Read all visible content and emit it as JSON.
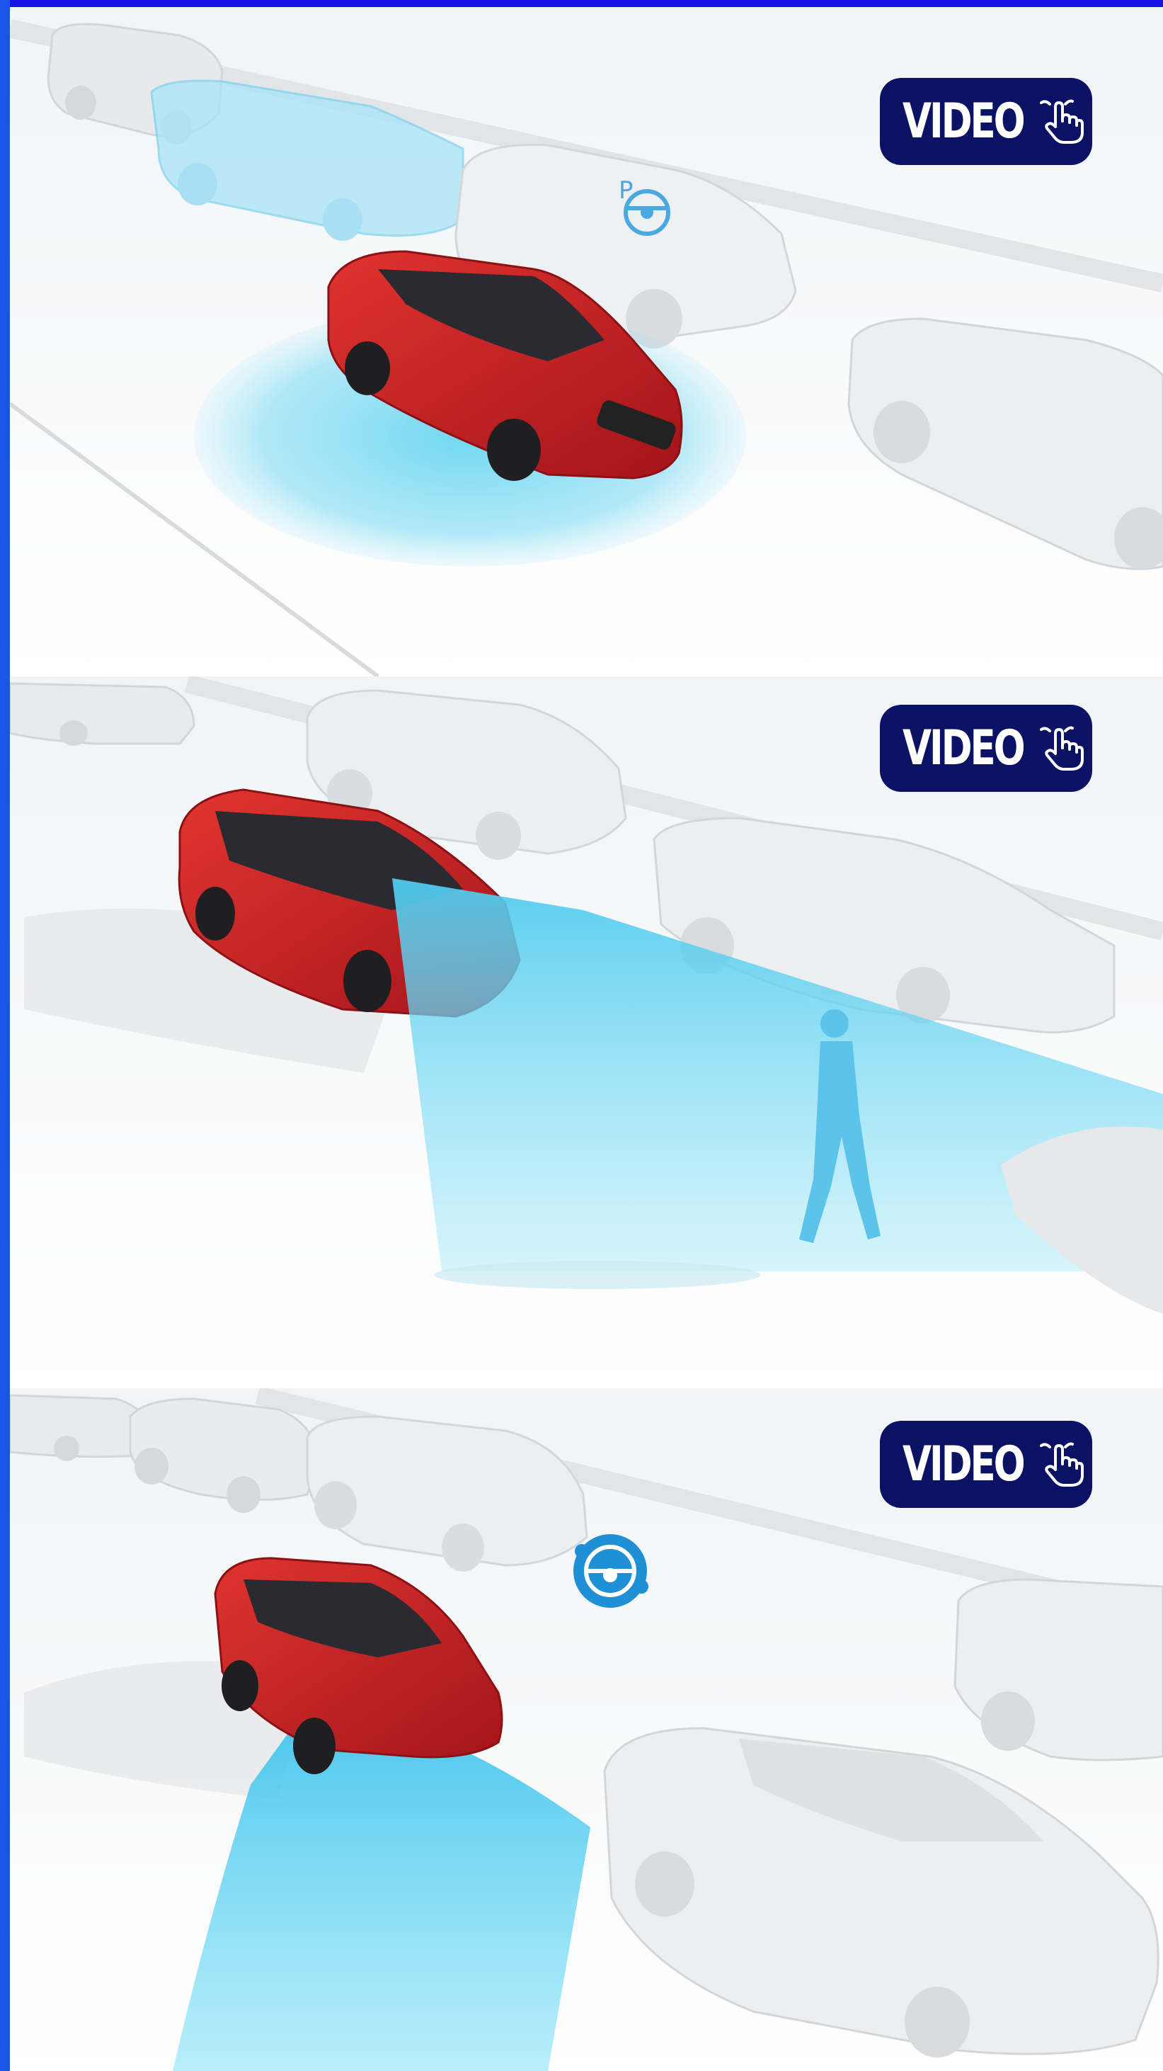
{
  "colors": {
    "top_bar": "#1a14e6",
    "left_bar": "#1a54e8",
    "button_bg": "#0b1266",
    "button_text": "#ffffff",
    "car_red": "#d62a2a",
    "sensor_blue": "#5fd3f0",
    "ghost_car": "#e9ebec"
  },
  "panels": [
    {
      "scene": "parking-assist-parallel",
      "video_button": {
        "label": "VIDEO",
        "icon": "pointing-hand-icon"
      },
      "overlay_icon": "parking-steering-wheel-icon"
    },
    {
      "scene": "reverse-pedestrian-detection",
      "video_button": {
        "label": "VIDEO",
        "icon": "pointing-hand-icon"
      }
    },
    {
      "scene": "active-park-exit",
      "video_button": {
        "label": "VIDEO",
        "icon": "pointing-hand-icon"
      },
      "overlay_icon": "steering-wheel-icon"
    }
  ]
}
